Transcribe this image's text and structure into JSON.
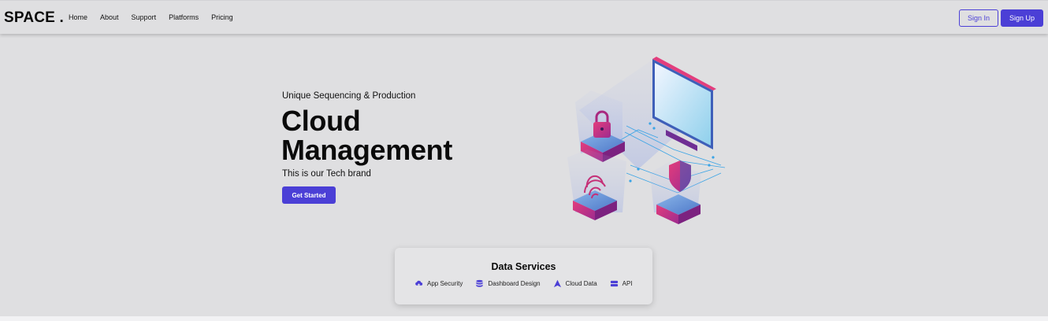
{
  "brand": {
    "logo": "SPACE ."
  },
  "nav": {
    "links": [
      "Home",
      "About",
      "Support",
      "Platforms",
      "Pricing"
    ],
    "sign_in": "Sign In",
    "sign_up": "Sign Up"
  },
  "hero": {
    "subtitle": "Unique Sequencing & Production",
    "title": "Cloud Management",
    "tagline": "This is our Tech brand",
    "cta": "Get Started",
    "illustration_icon": "cloud-security-illustration"
  },
  "services": {
    "title": "Data Services",
    "items": [
      {
        "label": "App Security",
        "icon": "cloud-upload-icon"
      },
      {
        "label": "Dashboard Design",
        "icon": "database-icon"
      },
      {
        "label": "Cloud Data",
        "icon": "triangle-icon"
      },
      {
        "label": "API",
        "icon": "server-icon"
      }
    ]
  },
  "colors": {
    "accent": "#4b3fd6",
    "background": "#dfdfe1",
    "illustration_pink": "#d6336e",
    "illustration_blue": "#2b6cd6"
  }
}
